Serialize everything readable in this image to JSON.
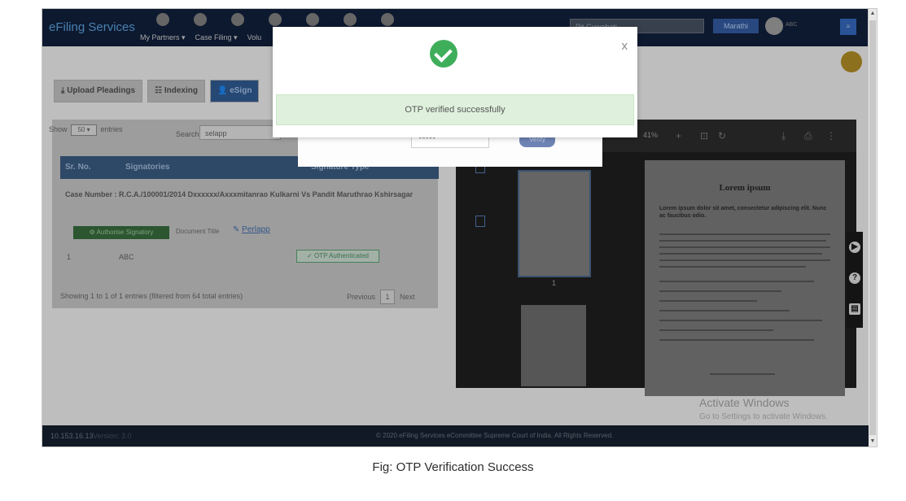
{
  "app": {
    "brand": "eFiling Services",
    "nav_menu": [
      "My Partners ▾",
      "Case Filing ▾",
      "Volu"
    ],
    "top_select": "Pit Guwahati",
    "top_button": "Marathi",
    "top_user": "ABC",
    "top_square": "≡"
  },
  "tabs": [
    {
      "label": "⤓ Upload Pleadings"
    },
    {
      "label": "☷ Indexing"
    },
    {
      "label": "👤 eSign"
    }
  ],
  "list": {
    "show_prefix": "Show",
    "show_value": "50 ▾",
    "show_suffix": "entries",
    "search_label": "Search:",
    "search_value": "selapp",
    "columns": [
      "Sr. No.",
      "Signatories",
      "Signature Type"
    ],
    "case_number_line": "Case Number : R.C.A./100001/2014 Dxxxxxx/Axxxmitanrao Kulkarni Vs Pandit Maruthrao Kshirsagar",
    "auth_button": "⚙ Authorise Signatory",
    "document_title_label": "Document Title",
    "document_title_link": "Perlapp",
    "row": {
      "sr": "1",
      "signatory": "ABC",
      "status": "✓ OTP Authenticated"
    },
    "info": "Showing 1 to 1 of 1 entries (filtered from 64 total entries)",
    "prev": "Previous",
    "page": "1",
    "next": "Next"
  },
  "viewer": {
    "zoom": "41%",
    "page_number": "1",
    "page_title": "Lorem ipsum",
    "page_subtitle": "Lorem ipsum dolor sit amet, consectetur adipiscing elit. Nunc ac faucibus odio."
  },
  "watermark": {
    "title": "Activate Windows",
    "subtitle": "Go to Settings to activate Windows."
  },
  "footer": {
    "ip": "10.153.16.13",
    "version": "Version: 3.0",
    "copyright": "© 2020 eFiling Services eCommittee Supreme Court of India. All Rights Reserved."
  },
  "modal": {
    "close": "x",
    "message": "OTP verified successfully",
    "otp_value": "*****",
    "verify_label": "Verify"
  },
  "caption": "Fig: OTP Verification Success"
}
